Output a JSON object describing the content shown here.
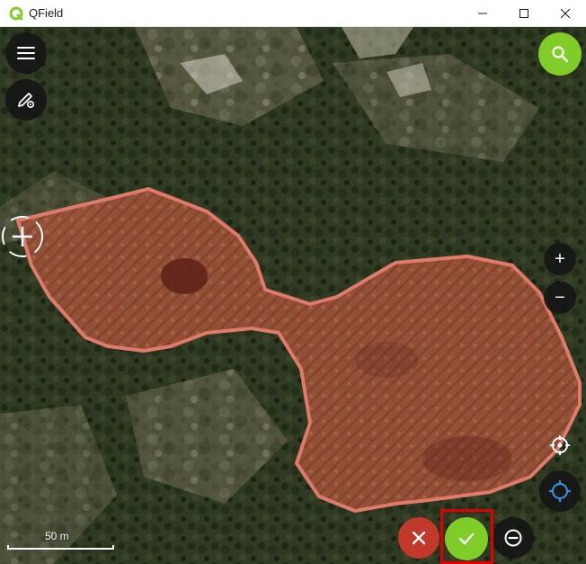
{
  "window": {
    "title": "QField",
    "minimize_icon": "minimize-icon",
    "maximize_icon": "maximize-icon",
    "close_icon": "close-icon"
  },
  "map": {
    "scale_label": "50 m",
    "polygon_fill": "#b0503a",
    "polygon_stroke": "#e07a6a"
  },
  "controls": {
    "menu_icon": "hamburger-menu-icon",
    "digitize_icon": "pencil-settings-icon",
    "search_icon": "search-icon",
    "zoom_in_label": "+",
    "zoom_out_label": "−",
    "crosshair_icon": "crosshair-icon",
    "locate_icon": "gps-locate-icon",
    "cancel_icon": "close-x-icon",
    "confirm_icon": "checkmark-icon",
    "remove_vertex_icon": "minus-circle-icon"
  },
  "colors": {
    "accent": "#80cc28",
    "cancel": "#c0392b",
    "dark_button": "#141414",
    "highlight": "#e00000"
  }
}
